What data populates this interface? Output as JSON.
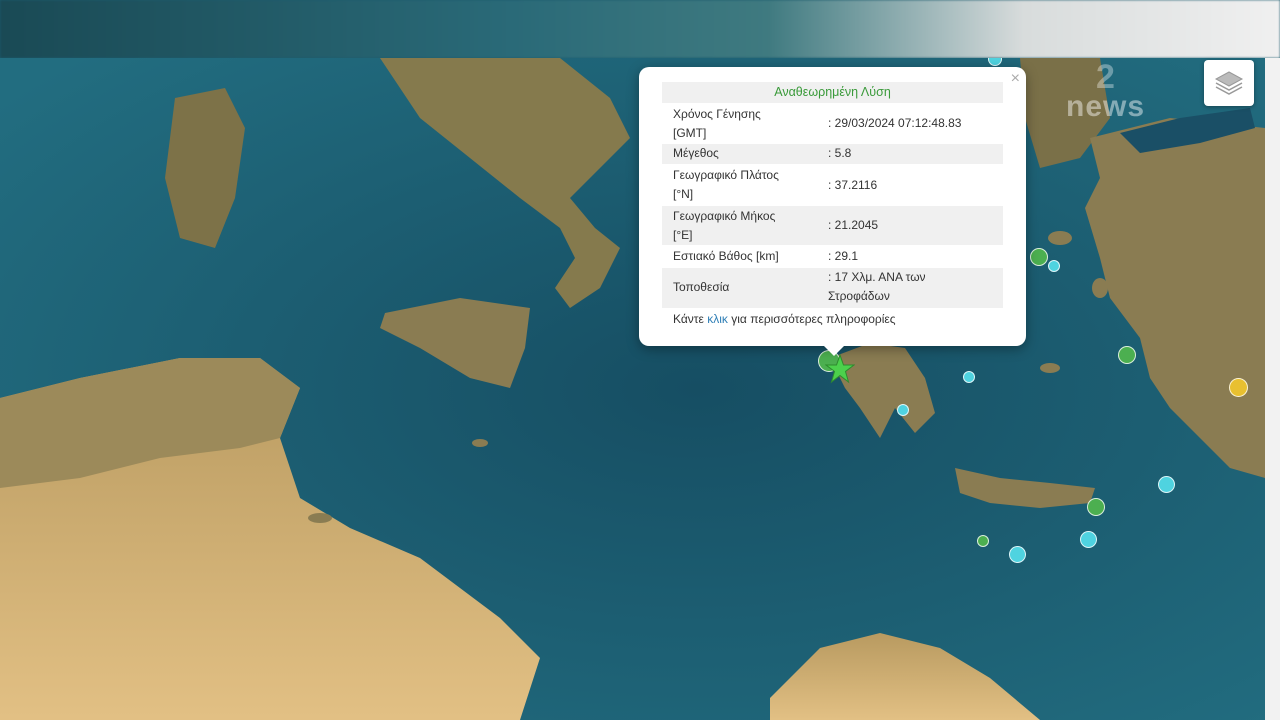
{
  "popup": {
    "title": "Αναθεωρημένη Λύση",
    "close_symbol": "×",
    "rows": [
      {
        "label_line1": "Χρόνος Γένησης",
        "label_line2": "[GMT]",
        "value_line1": ": 29/03/2024 07:12:48.83",
        "value_line2": ""
      },
      {
        "label_line1": "Μέγεθος",
        "label_line2": "",
        "value_line1": ": 5.8",
        "value_line2": ""
      },
      {
        "label_line1": "Γεωγραφικό Πλάτος",
        "label_line2": "[°N]",
        "value_line1": ": 37.2116",
        "value_line2": ""
      },
      {
        "label_line1": "Γεωγραφικό Μήκος",
        "label_line2": "[°E]",
        "value_line1": ": 21.2045",
        "value_line2": ""
      },
      {
        "label_line1": "Εστιακό Βάθος [km]",
        "label_line2": "",
        "value_line1": ": 29.1",
        "value_line2": ""
      },
      {
        "label_line1": "Τοποθεσία",
        "label_line2": "",
        "value_line1": ": 17 Χλμ. ΑΝΑ των",
        "value_line2": "Στροφάδων"
      }
    ],
    "more_prefix": "Κάντε",
    "more_link": "κλικ",
    "more_suffix": "για περισσότερες πληροφορίες"
  },
  "watermark": {
    "number": "2",
    "text": "news"
  },
  "map": {
    "sea_color": "#1c5b6e",
    "land_color": "#8a7c52",
    "desert_color": "#d8b47a",
    "epicenter_icon": "star-icon",
    "epicenter_color": "#4cd14c",
    "marker_colors": {
      "green": "#4caf50",
      "cyan": "#4fd3e0",
      "yellow": "#e8c030"
    }
  },
  "controls": {
    "layers_icon": "layers-icon"
  }
}
